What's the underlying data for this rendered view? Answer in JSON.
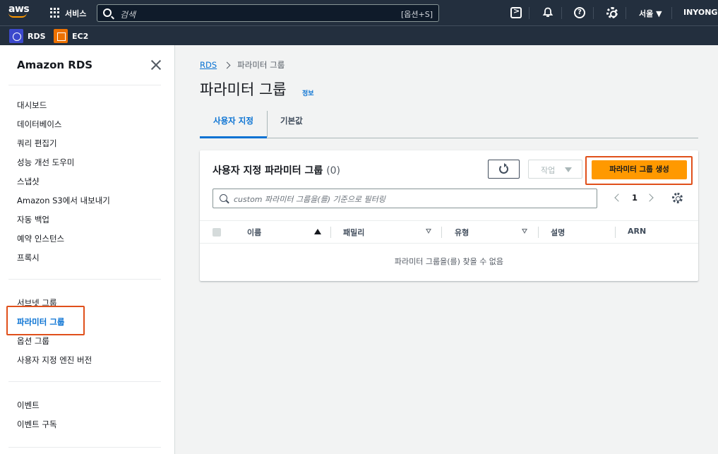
{
  "topnav": {
    "logo": "aws",
    "services_label": "서비스",
    "search_placeholder": "검색",
    "search_shortcut": "[옵션+S]",
    "region": "서울 ▼",
    "user": "INYONG K"
  },
  "favorites": [
    {
      "label": "RDS",
      "color": "#3b48cc"
    },
    {
      "label": "EC2",
      "color": "#ed7100"
    }
  ],
  "sidebar": {
    "title": "Amazon RDS",
    "group1": [
      "대시보드",
      "데이터베이스",
      "쿼리 편집기",
      "성능 개선 도우미",
      "스냅샷",
      "Amazon S3에서 내보내기",
      "자동 백업",
      "예약 인스턴스",
      "프록시"
    ],
    "group2": [
      "서브넷 그룹",
      "파라미터 그룹",
      "옵션 그룹",
      "사용자 지정 엔진 버전"
    ],
    "group3": [
      "이벤트",
      "이벤트 구독"
    ],
    "active_item": "파라미터 그룹"
  },
  "breadcrumb": {
    "root": "RDS",
    "current": "파라미터 그룹"
  },
  "page": {
    "title": "파라미터 그룹",
    "info": "정보"
  },
  "tabs": [
    {
      "label": "사용자 지정",
      "active": true
    },
    {
      "label": "기본값",
      "active": false
    }
  ],
  "table": {
    "title": "사용자 지정 파라미터 그룹",
    "count": "(0)",
    "action_label": "작업",
    "create_label": "파라미터 그룹 생성",
    "filter_placeholder": "custom 파라미터 그룹을(를) 기준으로 필터링",
    "page_number": "1",
    "columns": [
      "이름",
      "패밀리",
      "유형",
      "설명",
      "ARN"
    ],
    "empty_message": "파라미터 그룹을(를) 찾을 수 없음"
  },
  "colors": {
    "nav_bg": "#232f3e",
    "accent_link": "#0972d3",
    "primary_button": "#ff9900",
    "highlight": "#e0501b"
  }
}
